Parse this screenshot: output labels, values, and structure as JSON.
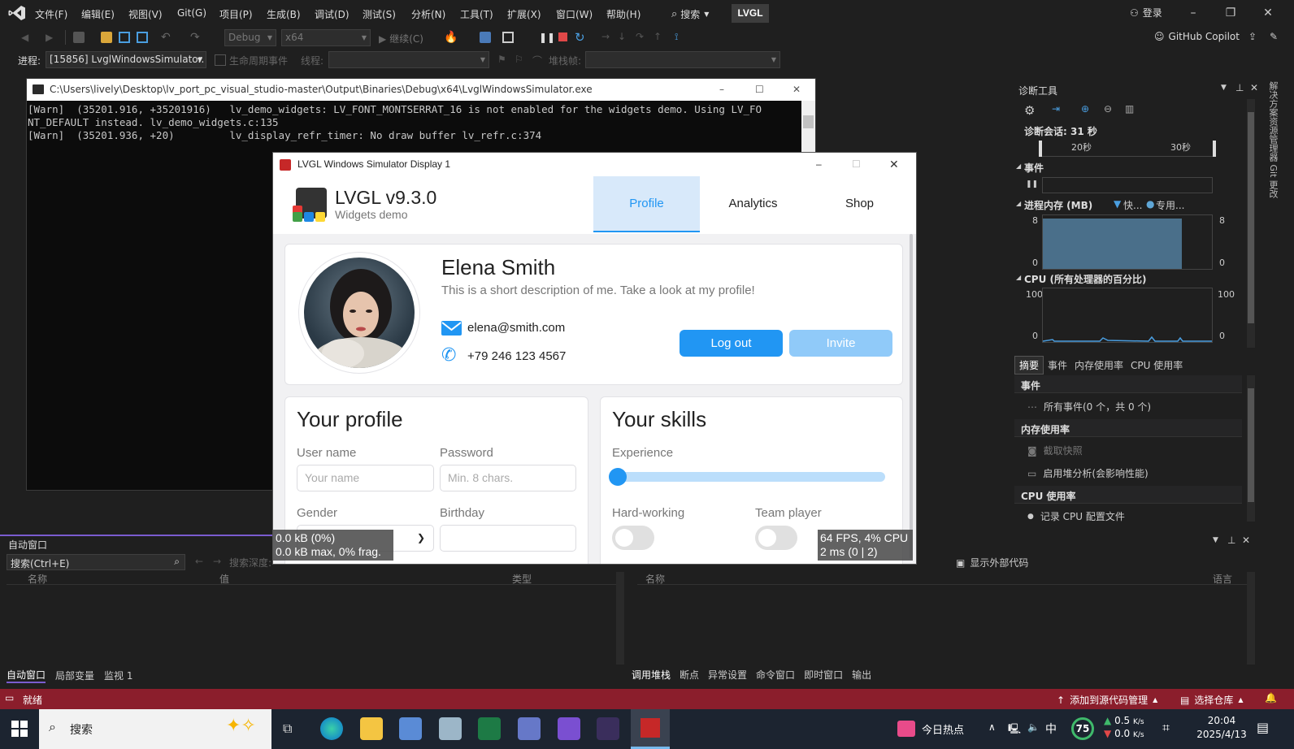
{
  "menubar": {
    "items": [
      "文件(F)",
      "编辑(E)",
      "视图(V)",
      "Git(G)",
      "项目(P)",
      "生成(B)",
      "调试(D)",
      "测试(S)",
      "分析(N)",
      "工具(T)",
      "扩展(X)",
      "窗口(W)",
      "帮助(H)"
    ],
    "search_label": "搜索",
    "solution_badge": "LVGL",
    "login_label": "登录"
  },
  "toolbar": {
    "config": "Debug",
    "platform": "x64",
    "continue_label": "继续(C)",
    "copilot_label": "GitHub Copilot",
    "process_label": "进程:",
    "process_value": "[15856] LvglWindowsSimulator.",
    "lifecycle_label": "生命周期事件",
    "thread_label": "线程:",
    "stackframe_label": "堆栈帧:"
  },
  "console": {
    "title": "C:\\Users\\lively\\Desktop\\lv_port_pc_visual_studio-master\\Output\\Binaries\\Debug\\x64\\LvglWindowsSimulator.exe",
    "lines": [
      "[Warn]  (35201.916, +35201916)   lv_demo_widgets: LV_FONT_MONTSERRAT_16 is not enabled for the widgets demo. Using LV_FO",
      "NT_DEFAULT instead. lv_demo_widgets.c:135",
      "[Warn]  (35201.936, +20)         lv_display_refr_timer: No draw buffer lv_refr.c:374"
    ]
  },
  "diag": {
    "title": "诊断工具",
    "session": "诊断会话: 31 秒",
    "tick_20": "20秒",
    "tick_30": "30秒",
    "events_label": "事件",
    "memory_label": "进程内存 (MB)",
    "legend_fast": "快...",
    "legend_private": "专用...",
    "mem_max": "8",
    "mem_min": "0",
    "cpu_label": "CPU (所有处理器的百分比)",
    "cpu_max": "100",
    "cpu_min": "0",
    "tabs": [
      "摘要",
      "事件",
      "内存使用率",
      "CPU 使用率"
    ],
    "sec_events": "事件",
    "all_events": "所有事件(0 个，共 0 个)",
    "sec_memory": "内存使用率",
    "snapshot": "截取快照",
    "heap_profile": "启用堆分析(会影响性能)",
    "sec_cpu": "CPU 使用率",
    "record_cpu": "记录 CPU 配置文件",
    "vertical_tabs": "解决方案资源管理器  Git 更改",
    "memory_fill": 0.82
  },
  "lvgl": {
    "window_title": "LVGL Windows Simulator Display 1",
    "app_title": "LVGL v9.3.0",
    "app_subtitle": "Widgets demo",
    "tabs": [
      "Profile",
      "Analytics",
      "Shop"
    ],
    "name": "Elena Smith",
    "description": "This is a short description of me. Take a look at my profile!",
    "email": "elena@smith.com",
    "phone": "+79 246 123 4567",
    "logout": "Log out",
    "invite": "Invite",
    "your_profile": "Your profile",
    "username_label": "User name",
    "username_placeholder": "Your name",
    "password_label": "Password",
    "password_placeholder": "Min. 8 chars.",
    "gender_label": "Gender",
    "birthday_label": "Birthday",
    "your_skills": "Your skills",
    "experience_label": "Experience",
    "experience_value": 0,
    "hardworking_label": "Hard-working",
    "teamplayer_label": "Team player",
    "mem_line1": "0.0 kB (0%)",
    "mem_line2": "0.0 kB max, 0% frag.",
    "fps_line1": "64 FPS, 4% CPU",
    "fps_line2": "2 ms (0 | 2)",
    "accent": "#2196f3"
  },
  "autowin": {
    "title": "自动窗口",
    "search_placeholder": "搜索(Ctrl+E)",
    "depth_label": "搜索深度:",
    "col_name": "名称",
    "col_value": "值",
    "col_type": "类型",
    "tabs": [
      "自动窗口",
      "局部变量",
      "监视 1"
    ]
  },
  "callstack": {
    "show_external": "显示外部代码",
    "col_name": "名称",
    "col_lang": "语言",
    "tabs": [
      "调用堆栈",
      "断点",
      "异常设置",
      "命令窗口",
      "即时窗口",
      "输出"
    ]
  },
  "statusbar": {
    "ready": "就绪",
    "add_source": "添加到源代码管理",
    "select_repo": "选择仓库"
  },
  "taskbar": {
    "search": "搜索",
    "news": "今日热点",
    "ime": "中",
    "badge": "75",
    "net_up": "0.5",
    "net_down": "0.0",
    "net_unit": "K/s",
    "time": "20:04",
    "date": "2025/4/13"
  }
}
